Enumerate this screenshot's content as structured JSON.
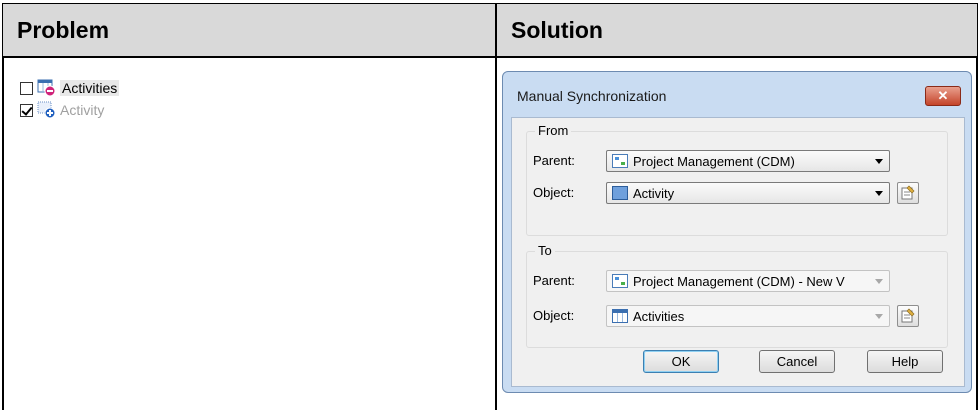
{
  "headers": {
    "problem": "Problem",
    "solution": "Solution"
  },
  "tree": [
    {
      "label": "Activities",
      "checked": false,
      "icon": "table-remove-icon"
    },
    {
      "label": "Activity",
      "checked": true,
      "icon": "entity-add-icon"
    }
  ],
  "dialog": {
    "title": "Manual Synchronization",
    "close": "✕",
    "from": {
      "legend": "From",
      "parent_label": "Parent:",
      "parent_value": "Project Management (CDM)",
      "object_label": "Object:",
      "object_value": "Activity"
    },
    "to": {
      "legend": "To",
      "parent_label": "Parent:",
      "parent_value": "Project Management (CDM) - New V",
      "object_label": "Object:",
      "object_value": "Activities"
    },
    "buttons": {
      "ok": "OK",
      "cancel": "Cancel",
      "help": "Help"
    }
  },
  "colors": {
    "header_bg": "#d9d9d9",
    "dialog_frame": "#c9dcf2",
    "close_button": "#c4442a"
  }
}
